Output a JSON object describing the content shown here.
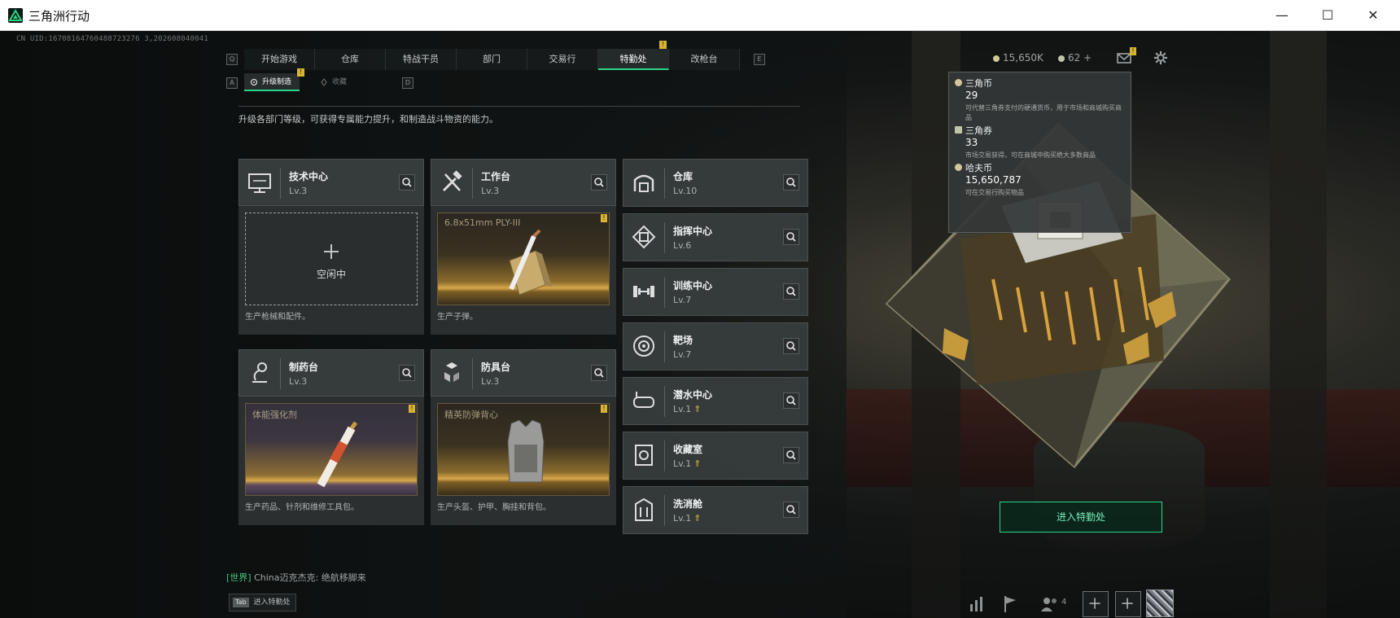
{
  "window": {
    "title": "三角洲行动",
    "minimize": "—",
    "maximize": "☐",
    "close": "✕"
  },
  "uid": "CN UID:16708164760488723276 3,202608040041",
  "tabs": {
    "prev_key": "Q",
    "next_key": "E",
    "items": [
      {
        "label": "开始游戏"
      },
      {
        "label": "仓库"
      },
      {
        "label": "特战干员"
      },
      {
        "label": "部门"
      },
      {
        "label": "交易行"
      },
      {
        "label": "特勤处",
        "alert": "!"
      },
      {
        "label": "改枪台"
      }
    ]
  },
  "subtabs": {
    "prev_key": "A",
    "next_key": "D",
    "items": [
      {
        "label": "升级制造",
        "alert": "!"
      },
      {
        "label": "收藏"
      }
    ]
  },
  "description": "升级各部门等级，可获得专属能力提升，和制造战斗物资的能力。",
  "workshops": [
    {
      "name": "技术中心",
      "level": "Lv.3",
      "status": "空闲中",
      "idle_plus": "+",
      "footer": "生产枪械和配件。",
      "icon": "monitor-icon"
    },
    {
      "name": "工作台",
      "level": "Lv.3",
      "item": "6.8x51mm PLY-III",
      "alert": "!",
      "footer": "生产子弹。",
      "icon": "tools-icon"
    },
    {
      "name": "制药台",
      "level": "Lv.3",
      "item": "体能强化剂",
      "alert": "!",
      "footer": "生产药品、针剂和维修工具包。",
      "icon": "microscope-icon"
    },
    {
      "name": "防具台",
      "level": "Lv.3",
      "item": "精英防弹背心",
      "alert": "!",
      "footer": "生产头盔、护甲、胸挂和背包。",
      "icon": "cubes-icon"
    }
  ],
  "departments": [
    {
      "name": "仓库",
      "level": "Lv.10",
      "icon": "warehouse-icon"
    },
    {
      "name": "指挥中心",
      "level": "Lv.6",
      "icon": "command-icon"
    },
    {
      "name": "训练中心",
      "level": "Lv.7",
      "icon": "dumbbell-icon"
    },
    {
      "name": "靶场",
      "level": "Lv.7",
      "icon": "target-icon"
    },
    {
      "name": "潜水中心",
      "level": "Lv.1",
      "upgrade": "⇑",
      "icon": "diving-mask-icon"
    },
    {
      "name": "收藏室",
      "level": "Lv.1",
      "upgrade": "⇑",
      "icon": "collection-icon"
    },
    {
      "name": "洗消舱",
      "level": "Lv.1",
      "upgrade": "⇑",
      "icon": "decon-icon"
    }
  ],
  "hud": {
    "hafu_short": "15,650K",
    "coupons": "62",
    "coupons_add": "+",
    "mail_alert": "!"
  },
  "currency_tooltip": [
    {
      "name": "三角币",
      "value": "29",
      "note": "可代替三角券支付的硬通货币，用于市场和商城购买商品"
    },
    {
      "name": "三角券",
      "value": "33",
      "note": "市场交易获得，可在商城中购买绝大多数商品"
    },
    {
      "name": "哈夫币",
      "value": "15,650,787",
      "note": "可在交易行购买物品"
    }
  ],
  "enter_button": "进入特勤处",
  "chat": {
    "channel": "[世界]",
    "message": " China迈克杰克: 绝航移脚来"
  },
  "tab_hint": {
    "key": "Tab",
    "label": "进入特勤处"
  },
  "bottom": {
    "squad_count": "4",
    "add": "+"
  },
  "colors": {
    "accent": "#2bd58a",
    "alert": "#d9b431",
    "panel": "#373c3c"
  }
}
